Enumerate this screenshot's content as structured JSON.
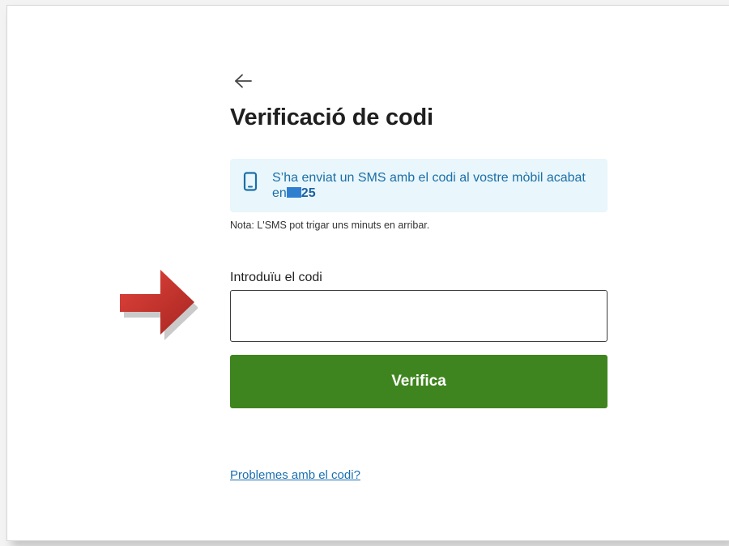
{
  "header": {
    "back_icon": "arrow-left-icon",
    "title": "Verificació de codi"
  },
  "info": {
    "icon": "mobile-phone-icon",
    "text": "S’ha enviat un SMS amb el codi al vostre mòbil acabat en",
    "masked_digits_visible": "25"
  },
  "note": "Nota: L'SMS pot trigar uns minuts en arribar.",
  "form": {
    "code_label": "Introduïu el codi",
    "code_value": "",
    "submit_label": "Verifica"
  },
  "help_link": "Problemes amb el codi?",
  "annotation": {
    "icon": "red-arrow-icon"
  },
  "colors": {
    "accent_green": "#3f851f",
    "info_bg": "#e9f6fb",
    "info_text": "#1b6fa8",
    "link": "#1a6fb0",
    "arrow_red": "#c9322d"
  }
}
